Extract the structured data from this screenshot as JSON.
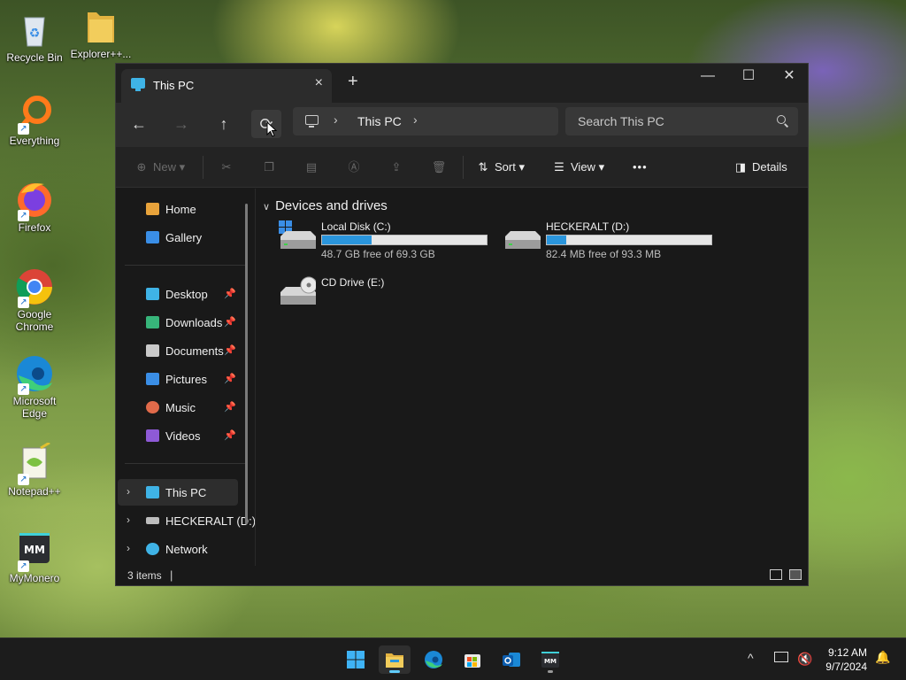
{
  "desktop": {
    "icons": [
      {
        "label": "Recycle Bin"
      },
      {
        "label": "Explorer++..."
      },
      {
        "label": "Everything"
      },
      {
        "label": "Firefox"
      },
      {
        "label": "Google Chrome"
      },
      {
        "label": "Microsoft Edge"
      },
      {
        "label": "Notepad++"
      },
      {
        "label": "MyMonero"
      }
    ]
  },
  "window": {
    "tab_title": "This PC",
    "new_tab": "+",
    "tab_close": "×",
    "caption": {
      "minimize": "—",
      "maximize": "☐",
      "close": "✕"
    }
  },
  "navbar": {
    "back": "←",
    "forward": "→",
    "up": "↑",
    "refresh": "⟳",
    "breadcrumb": [
      "This PC"
    ],
    "search_placeholder": "Search This PC"
  },
  "commandbar": {
    "new_label": "New",
    "sort_label": "Sort",
    "view_label": "View",
    "more": "•••",
    "details_label": "Details"
  },
  "sidebar": {
    "quick": [
      {
        "label": "Home",
        "icon": "home-icon",
        "color": "#e8a33b"
      },
      {
        "label": "Gallery",
        "icon": "gallery-icon",
        "color": "#3a8ee6"
      }
    ],
    "pinned": [
      {
        "label": "Desktop",
        "icon": "desktop-icon",
        "color": "#3fb3e6"
      },
      {
        "label": "Downloads",
        "icon": "downloads-icon",
        "color": "#37b57a"
      },
      {
        "label": "Documents",
        "icon": "documents-icon",
        "color": "#c9c9c9"
      },
      {
        "label": "Pictures",
        "icon": "pictures-icon",
        "color": "#3a8ee6"
      },
      {
        "label": "Music",
        "icon": "music-icon",
        "color": "#e06a4a"
      },
      {
        "label": "Videos",
        "icon": "videos-icon",
        "color": "#8e5ad6"
      }
    ],
    "tree": [
      {
        "label": "This PC",
        "icon": "this-pc-icon",
        "color": "#3fb3e6"
      },
      {
        "label": "HECKERALT (D:)",
        "icon": "drive-icon",
        "color": "#bdbdbd"
      },
      {
        "label": "Network",
        "icon": "network-icon",
        "color": "#3fb3e6"
      }
    ]
  },
  "content": {
    "group_header": "Devices and drives",
    "drives": [
      {
        "name": "Local Disk (C:)",
        "free": "48.7 GB free of 69.3 GB",
        "used_fraction": 0.3
      },
      {
        "name": "HECKERALT (D:)",
        "free": "82.4 MB free of 93.3 MB",
        "used_fraction": 0.12
      },
      {
        "name": "CD Drive (E:)"
      }
    ]
  },
  "statusbar": {
    "item_count": "3 items"
  },
  "taskbar": {
    "time": "9:12 AM",
    "date": "9/7/2024",
    "chevron": "^",
    "bell": "🔔"
  },
  "colors": {
    "accent": "#60cdff",
    "drive_fill": "#2a95dc"
  }
}
